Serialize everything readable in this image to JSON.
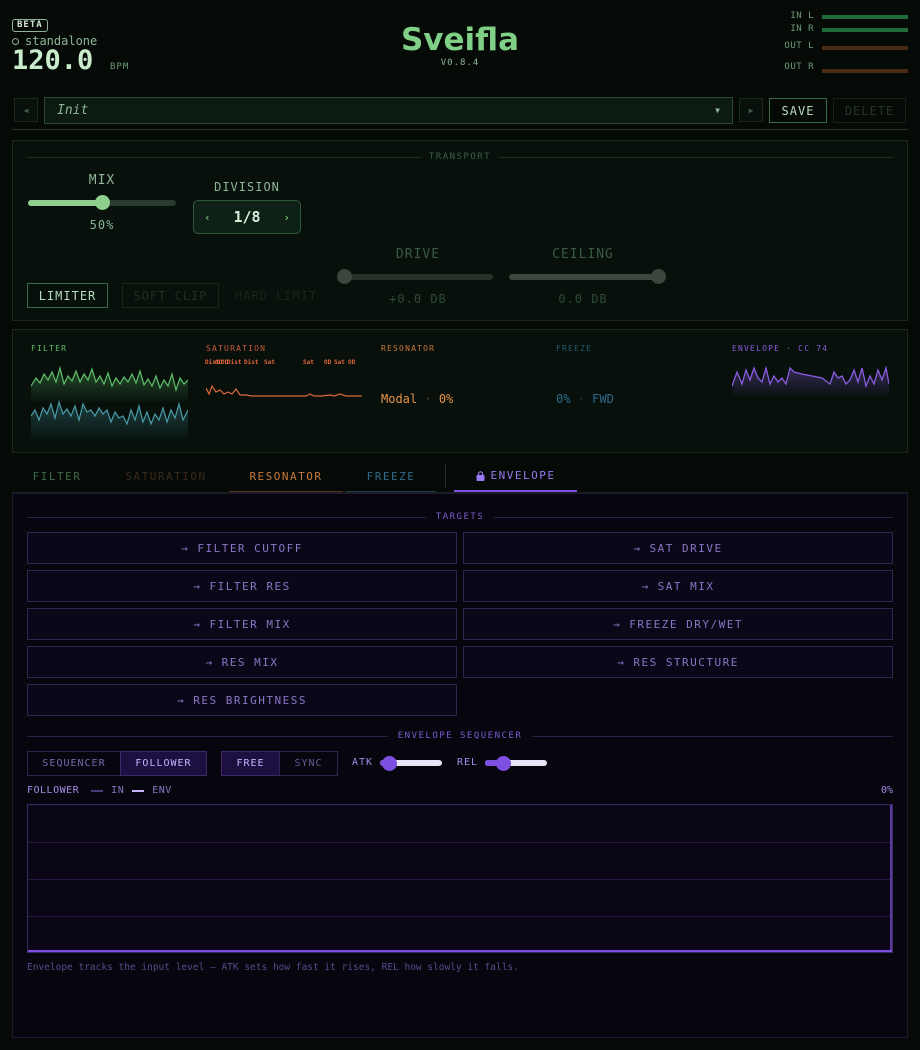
{
  "header": {
    "badge": "BETA",
    "mode": "standalone",
    "bpm": "120.0",
    "bpm_unit": "BPM",
    "title": "Sveifla",
    "version": "V0.8.4",
    "meters": [
      {
        "label": "IN L",
        "level": 1.0,
        "color": "#1f6a3a"
      },
      {
        "label": "IN R",
        "level": 1.0,
        "color": "#1f6a3a"
      },
      {
        "label": "OUT L",
        "level": 1.0,
        "color": "#4a2a12"
      },
      {
        "label": "OUT R",
        "level": 1.0,
        "color": "#4a2a12"
      }
    ]
  },
  "preset": {
    "prev": "◀",
    "next": "▶",
    "name": "Init",
    "caret": "▼",
    "save": "SAVE",
    "delete": "DELETE"
  },
  "transport": {
    "title": "TRANSPORT",
    "mix_label": "MIX",
    "mix_value": "50%",
    "mix_level": 0.5,
    "division_label": "DIVISION",
    "division_prev": "‹",
    "division_next": "›",
    "division_value": "1/8",
    "limiter": "LIMITER",
    "soft_clip": "SOFT CLIP",
    "hard_limit": "HARD LIMIT",
    "drive_label": "DRIVE",
    "drive_value": "+0.0 DB",
    "drive_level": 0.0,
    "ceiling_label": "CEILING",
    "ceiling_value": "0.0 DB",
    "ceiling_level": 1.0
  },
  "modules": {
    "filter": {
      "label": "FILTER",
      "color": "#5fbf6a"
    },
    "saturation": {
      "label": "SATURATION",
      "color": "#e0663a",
      "tags": [
        "Dist",
        "OD",
        "OD",
        "Dist",
        "Dist",
        "Sat",
        "Sat",
        "OD",
        "Sat",
        "OD"
      ]
    },
    "resonator": {
      "label": "RESONATOR",
      "mode": "Modal",
      "sep": "·",
      "value": "0%",
      "color": "#e8954a"
    },
    "freeze": {
      "label": "FREEZE",
      "value": "0%",
      "sep": "·",
      "dir": "FWD",
      "color": "#2f6a8a"
    },
    "envelope": {
      "label": "ENVELOPE · CC 74",
      "color": "#8a5ce0"
    }
  },
  "tabs": [
    {
      "label": "FILTER"
    },
    {
      "label": "SATURATION"
    },
    {
      "label": "RESONATOR"
    },
    {
      "label": "FREEZE"
    },
    {
      "label": "ENVELOPE",
      "icon": "lock-icon"
    }
  ],
  "envelope": {
    "targets_title": "TARGETS",
    "targets": [
      "→ FILTER CUTOFF",
      "→ SAT DRIVE",
      "→ FILTER RES",
      "→ SAT MIX",
      "→ FILTER MIX",
      "→ FREEZE DRY/WET",
      "→ RES MIX",
      "→ RES STRUCTURE",
      "→ RES BRIGHTNESS"
    ],
    "seq_title": "ENVELOPE SEQUENCER",
    "mode_sequencer": "SEQUENCER",
    "mode_follower": "FOLLOWER",
    "free": "FREE",
    "sync": "SYNC",
    "atk_label": "ATK",
    "atk_level": 0.15,
    "rel_label": "REL",
    "rel_level": 0.3,
    "follower_label": "FOLLOWER",
    "legend_in": "IN",
    "legend_env": "ENV",
    "value": "0%",
    "hint": "Envelope tracks the input level — ATK sets how fast it rises, REL how slowly it falls."
  }
}
